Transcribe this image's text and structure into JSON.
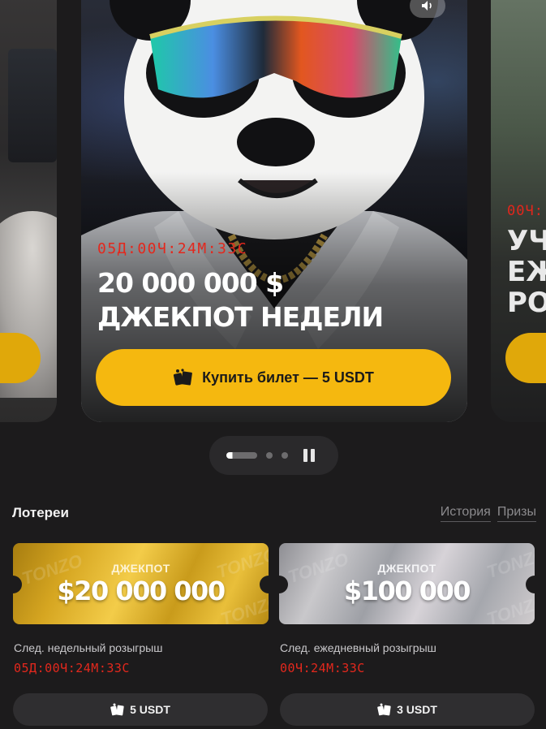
{
  "carousel": {
    "main_slide": {
      "timer": "05Д:00Ч:24М:33С",
      "headline_line1": "20 000 000 $",
      "headline_line2": "ДЖЕКПОТ НЕДЕЛИ",
      "buy_button_label": "Купить билет — 5 USDT"
    },
    "next_slide": {
      "timer_partial": "00Ч:",
      "title_partial": "УЧА\nЕЖ\nРОЗ"
    },
    "pager": {
      "slide_count": 3,
      "active_index": 0
    }
  },
  "lotteries": {
    "title": "Лотереи",
    "links": [
      "История",
      "Призы"
    ],
    "items": [
      {
        "ticket_label": "ДЖЕКПОТ",
        "amount": "$20 000 000",
        "draw_label": "След. недельный розыгрыш",
        "draw_timer": "05Д:00Ч:24М:33С",
        "price": "5 USDT",
        "style": "gold"
      },
      {
        "ticket_label": "ДЖЕКПОТ",
        "amount": "$100 000",
        "draw_label": "След. ежедневный розыгрыш",
        "draw_timer": "00Ч:24М:33С",
        "price": "3 USDT",
        "style": "silver"
      }
    ],
    "watermark": "TONZO"
  },
  "colors": {
    "background": "#1c1b1c",
    "accent_yellow": "#f5b80f",
    "timer_red": "#e3281d"
  },
  "icons": [
    "sound-icon",
    "ticket-icon",
    "pause-icon"
  ]
}
